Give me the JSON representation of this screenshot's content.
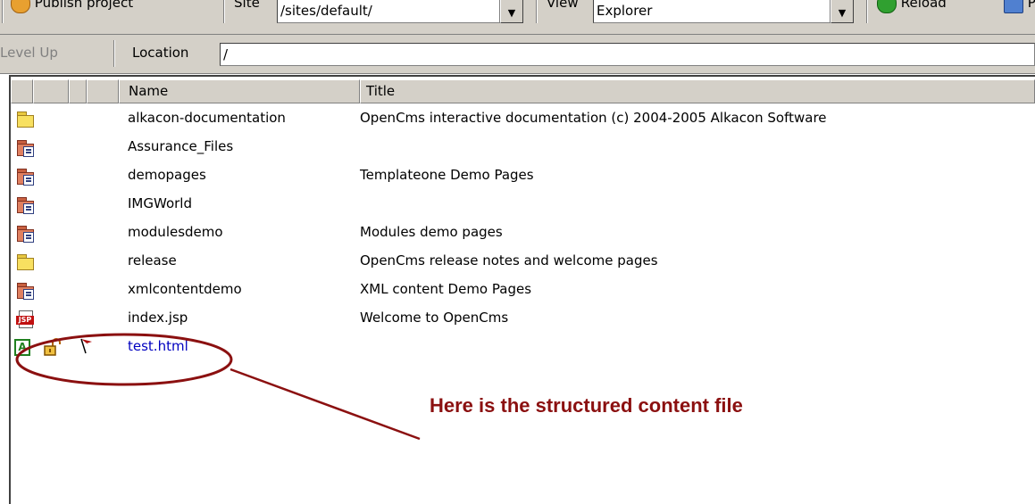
{
  "toolbar": {
    "publish_label": "Publish project",
    "site_label": "Site",
    "site_value": "/sites/default/",
    "view_label": "View",
    "view_value": "Explorer",
    "reload_label": "Reload",
    "cut_label": "P"
  },
  "locbar": {
    "level_up_label": "Level Up",
    "location_label": "Location",
    "location_value": "/"
  },
  "list": {
    "columns": [
      "Name",
      "Title"
    ],
    "rows": [
      {
        "name": "alkacon-documentation",
        "title": "OpenCms interactive documentation (c) 2004-2005 Alkacon Software",
        "icon": "folder-icon"
      },
      {
        "name": "Assurance_Files",
        "title": "",
        "icon": "module-folder-icon"
      },
      {
        "name": "demopages",
        "title": "Templateone Demo Pages",
        "icon": "module-folder-icon"
      },
      {
        "name": "IMGWorld",
        "title": "",
        "icon": "module-folder-icon"
      },
      {
        "name": "modulesdemo",
        "title": "Modules demo pages",
        "icon": "module-folder-icon"
      },
      {
        "name": "release",
        "title": "OpenCms release notes and welcome pages",
        "icon": "folder-icon"
      },
      {
        "name": "xmlcontentdemo",
        "title": "XML content Demo Pages",
        "icon": "module-folder-icon"
      },
      {
        "name": "index.jsp",
        "title": "Welcome to OpenCms",
        "icon": "jsp-file-icon"
      },
      {
        "name": "test.html",
        "title": "",
        "icon": "xml-content-icon"
      }
    ]
  },
  "annotation": {
    "text": "Here is the structured content file",
    "color": "#8b1010"
  }
}
